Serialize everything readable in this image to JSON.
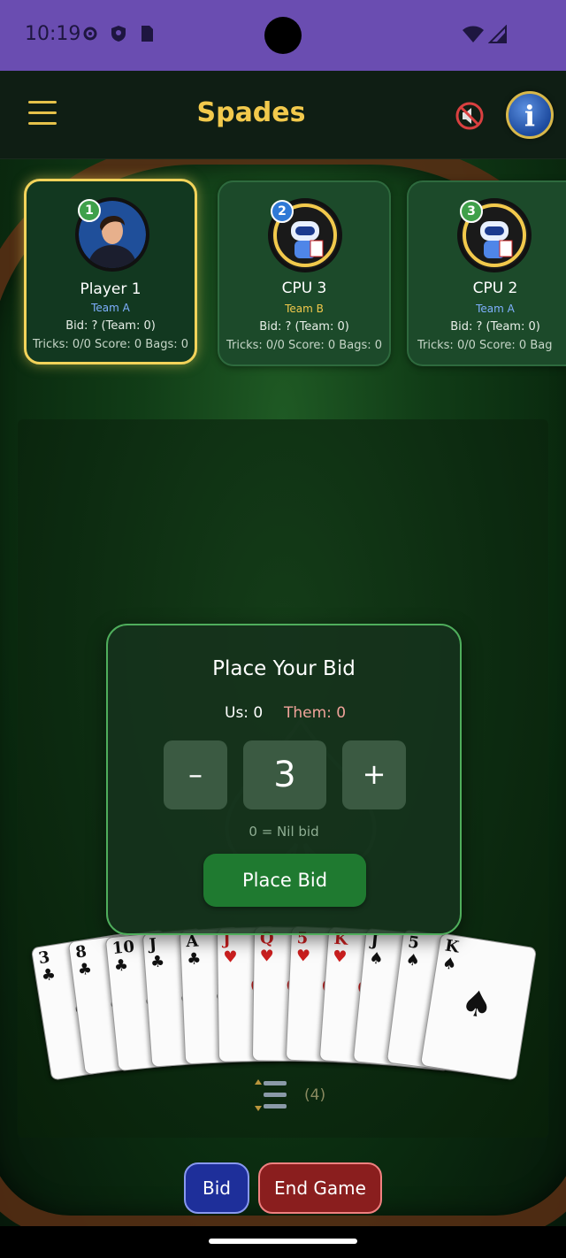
{
  "status_bar": {
    "time": "10:19",
    "icons": [
      "gear-icon",
      "shield-icon",
      "sim-card-icon",
      "wifi-icon",
      "signal-icon"
    ]
  },
  "app_bar": {
    "title": "Spades",
    "menu_icon": "hamburger-menu-icon",
    "sound_icon": "muted-speaker-icon",
    "info_label": "i"
  },
  "players": [
    {
      "seat": "1",
      "name": "Player 1",
      "team": "Team A",
      "bid": "Bid: ?  (Team: 0)",
      "stats": "Tricks: 0/0  Score: 0  Bags: 0",
      "active": true,
      "avatar": "human-avatar"
    },
    {
      "seat": "2",
      "name": "CPU 3",
      "team": "Team B",
      "bid": "Bid: ?  (Team: 0)",
      "stats": "Tricks: 0/0  Score: 0  Bags: 0",
      "active": false,
      "avatar": "robot-avatar"
    },
    {
      "seat": "3",
      "name": "CPU 2",
      "team": "Team A",
      "bid": "Bid: ?  (Team: 0)",
      "stats": "Tricks: 0/0  Score: 0  Bag",
      "active": false,
      "avatar": "robot-avatar"
    }
  ],
  "bid_dialog": {
    "title": "Place Your Bid",
    "us": "Us: 0",
    "them": "Them: 0",
    "minus": "–",
    "value": "3",
    "plus": "+",
    "hint": "0 = Nil bid",
    "submit": "Place Bid"
  },
  "hand": {
    "cards": [
      {
        "rank": "3",
        "suit": "♣",
        "color": "#111111"
      },
      {
        "rank": "8",
        "suit": "♣",
        "color": "#111111"
      },
      {
        "rank": "10",
        "suit": "♣",
        "color": "#111111"
      },
      {
        "rank": "J",
        "suit": "♣",
        "color": "#111111"
      },
      {
        "rank": "A",
        "suit": "♣",
        "color": "#111111"
      },
      {
        "rank": "J",
        "suit": "♥",
        "color": "#cc1f1f"
      },
      {
        "rank": "Q",
        "suit": "♥",
        "color": "#cc1f1f"
      },
      {
        "rank": "5",
        "suit": "♥",
        "color": "#cc1f1f"
      },
      {
        "rank": "K",
        "suit": "♥",
        "color": "#cc1f1f"
      },
      {
        "rank": "J",
        "suit": "♠",
        "color": "#111111"
      },
      {
        "rank": "5",
        "suit": "♠",
        "color": "#111111"
      },
      {
        "rank": "K",
        "suit": "♠",
        "color": "#111111"
      }
    ]
  },
  "sort": {
    "icon": "sort-cards-icon",
    "count": "(4)"
  },
  "actions": {
    "bid": "Bid",
    "end_game": "End Game"
  },
  "colors": {
    "accent_gold": "#f2c94c",
    "felt_green": "#113d17",
    "team_a": "#7fb0ff",
    "team_b": "#f2c94c",
    "status_bar": "#6a4db1"
  }
}
